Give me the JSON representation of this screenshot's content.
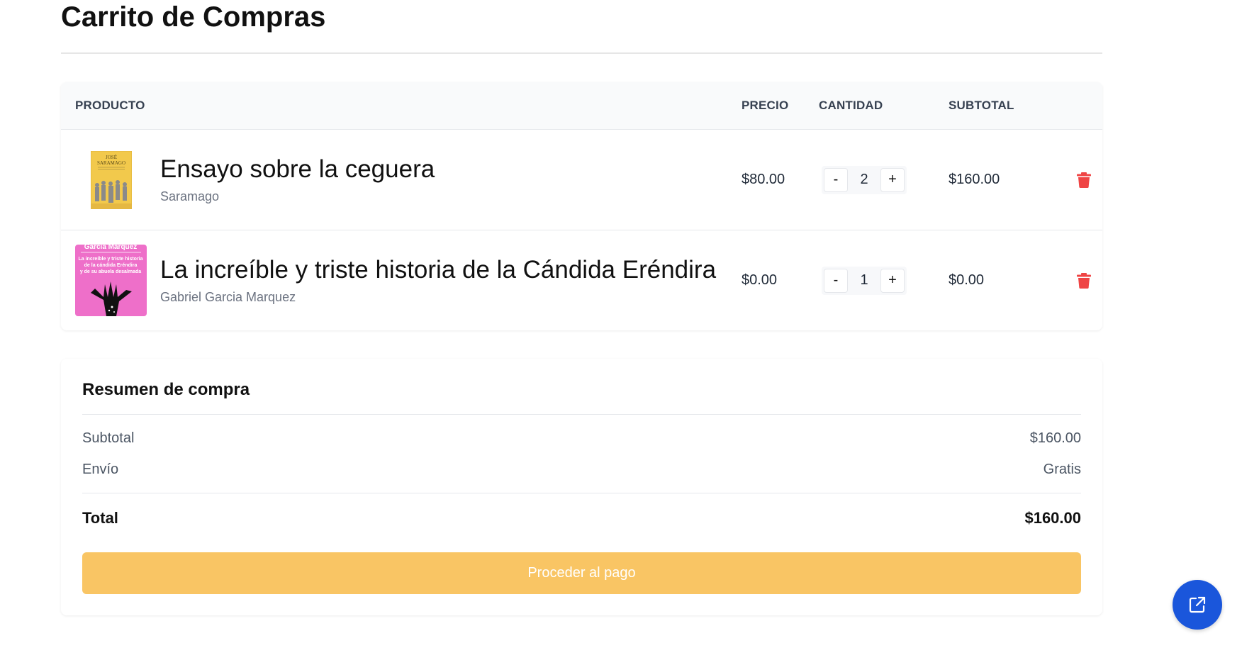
{
  "page": {
    "title": "Carrito de Compras"
  },
  "cart": {
    "columns": {
      "product": "Producto",
      "price": "Precio",
      "quantity": "Cantidad",
      "subtotal": "Subtotal"
    },
    "items": [
      {
        "name": "Ensayo sobre la ceguera",
        "author": "Saramago",
        "cover_text": [
          "JOSÉ",
          "SARAMAGO"
        ],
        "price": "$80.00",
        "quantity": "2",
        "subtotal": "$160.00",
        "decrement_label": "-",
        "increment_label": "+",
        "delete_icon": "trash-icon"
      },
      {
        "name": "La increíble y triste historia de la Cándida Eréndira",
        "author": "Gabriel Garcia Marquez",
        "cover_text": [
          "García Márquez",
          "La increíble y triste historia",
          "de la cándida Eréndira",
          "y de su abuela desalmada"
        ],
        "price": "$0.00",
        "quantity": "1",
        "subtotal": "$0.00",
        "decrement_label": "-",
        "increment_label": "+",
        "delete_icon": "trash-icon"
      }
    ]
  },
  "summary": {
    "title": "Resumen de compra",
    "subtotal_label": "Subtotal",
    "subtotal_value": "$160.00",
    "shipping_label": "Envío",
    "shipping_value": "Gratis",
    "total_label": "Total",
    "total_value": "$160.00",
    "checkout_label": "Proceder al pago"
  },
  "fab": {
    "icon": "external-link-icon"
  },
  "colors": {
    "accent": "#f9c564",
    "danger": "#ef4444",
    "fab": "#1a56db",
    "cover1": "#f2c94c",
    "cover2": "#ee6fc9"
  }
}
